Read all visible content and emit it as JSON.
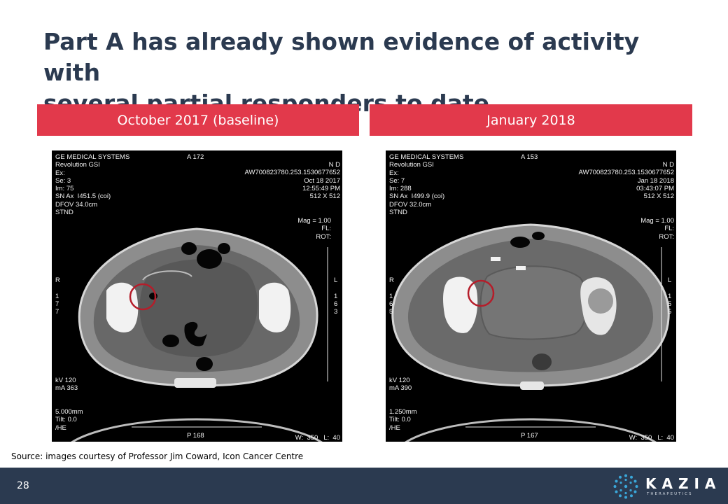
{
  "slide": {
    "title_line1": "Part A has already shown evidence of activity with",
    "title_line2": "several partial responders to date",
    "left_header": "October 2017 (baseline)",
    "right_header": "January 2018",
    "source": "Source: images courtesy of Professor Jim Coward, Icon Cancer Centre",
    "page_number": "28"
  },
  "scans": {
    "left": {
      "line1": "GE MEDICAL SYSTEMS",
      "line2": "Revolution GSI",
      "line3": "Ex:",
      "line4": "Se: 3",
      "line5": "Im: 75",
      "line6": "SN Ax  I451.5 (coi)",
      "line7": "DFOV 34.0cm",
      "line8": "STND",
      "anno_a": "A 172",
      "nd": "N D",
      "accession": "AW700823780.253.1530677652",
      "date": "Oct 18 2017",
      "time": "12:55:49 PM",
      "matrix": "512 X 512",
      "mag": "Mag = 1.00",
      "fl": "FL:",
      "rot": "ROT:",
      "right_marker": "R",
      "right_digits": "1\n7\n7",
      "left_marker": "L",
      "left_digits": "1\n6\n3",
      "kv": "kV 120",
      "ma": "mA 363",
      "thickness": "5.000mm",
      "tilt": "Tilt: 0.0",
      "he": "/HE",
      "p": "P 168",
      "window": "W:  350   L:  40"
    },
    "right": {
      "line1": "GE MEDICAL SYSTEMS",
      "line2": "Revolution GSI",
      "line3": "Ex:",
      "line4": "Se: 7",
      "line5": "Im: 288",
      "line6": "SN Ax  I499.9 (coi)",
      "line7": "DFOV 32.0cm",
      "line8": "STND",
      "anno_a": "A 153",
      "nd": "N D",
      "accession": "AW700823780.253.1530677652",
      "date": "Jan 18 2018",
      "time": "03:43:07 PM",
      "matrix": "512 X 512",
      "mag": "Mag = 1.00",
      "fl": "FL:",
      "rot": "ROT:",
      "right_marker": "R",
      "right_digits": "1\n6\n5",
      "left_marker": "L",
      "left_digits": "1\n5\n5",
      "kv": "kV 120",
      "ma": "mA 390",
      "thickness": "1.250mm",
      "tilt": "Tilt: 0.0",
      "he": "/HE",
      "p": "P 167",
      "window": "W:  350   L:  40"
    }
  },
  "logo": {
    "word": "KAZIA",
    "sub": "THERAPEUTICS",
    "icon": "dotted-circle-icon"
  },
  "colors": {
    "title": "#2b3a50",
    "header_bar": "#e2394b",
    "footer": "#2b3a50",
    "marker_circle": "#b51d2a",
    "logo_dots": "#3aa7d9"
  }
}
